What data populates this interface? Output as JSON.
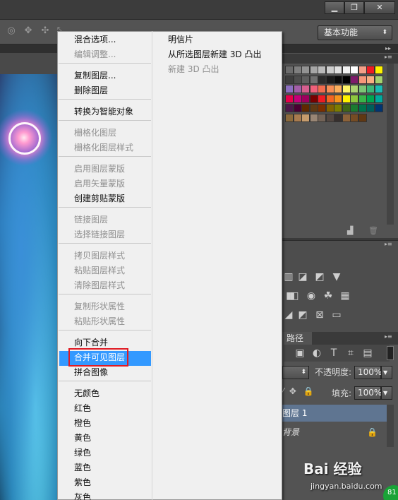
{
  "window": {
    "min": "▁",
    "restore": "❐",
    "close": "✕"
  },
  "options_bar": {
    "workspace": "基本功能"
  },
  "context_menu": {
    "col1": [
      {
        "label": "混合选项...",
        "disabled": false
      },
      {
        "label": "编辑调整...",
        "disabled": true
      },
      {
        "label": "复制图层...",
        "disabled": false
      },
      {
        "label": "删除图层",
        "disabled": false
      },
      {
        "label": "转换为智能对象",
        "disabled": false
      },
      {
        "label": "栅格化图层",
        "disabled": true
      },
      {
        "label": "栅格化图层样式",
        "disabled": true
      },
      {
        "label": "启用图层蒙版",
        "disabled": true
      },
      {
        "label": "启用矢量蒙版",
        "disabled": true
      },
      {
        "label": "创建剪贴蒙版",
        "disabled": false
      },
      {
        "label": "链接图层",
        "disabled": true
      },
      {
        "label": "选择链接图层",
        "disabled": true
      },
      {
        "label": "拷贝图层样式",
        "disabled": true
      },
      {
        "label": "粘贴图层样式",
        "disabled": true
      },
      {
        "label": "清除图层样式",
        "disabled": true
      },
      {
        "label": "复制形状属性",
        "disabled": true
      },
      {
        "label": "粘贴形状属性",
        "disabled": true
      },
      {
        "label": "向下合并",
        "disabled": false
      },
      {
        "label": "合并可见图层",
        "disabled": false,
        "highlighted": true
      },
      {
        "label": "拼合图像",
        "disabled": false
      },
      {
        "label": "无颜色",
        "disabled": false
      },
      {
        "label": "红色",
        "disabled": false
      },
      {
        "label": "橙色",
        "disabled": false
      },
      {
        "label": "黄色",
        "disabled": false
      },
      {
        "label": "绿色",
        "disabled": false
      },
      {
        "label": "蓝色",
        "disabled": false
      },
      {
        "label": "紫色",
        "disabled": false
      },
      {
        "label": "灰色",
        "disabled": false
      }
    ],
    "col2": [
      {
        "label": "明信片",
        "disabled": false
      },
      {
        "label": "从所选图层新建 3D 凸出",
        "disabled": false
      },
      {
        "label": "新建 3D 凸出",
        "disabled": true
      }
    ]
  },
  "layers_panel": {
    "tab": "路径",
    "opacity_label": "不透明度:",
    "opacity_value": "100%",
    "fill_label": "填充:",
    "fill_value": "100%",
    "layers": [
      {
        "name": "图层 1",
        "selected": true
      },
      {
        "name": "背景",
        "selected": false,
        "locked": true
      }
    ]
  },
  "watermark": {
    "brand": "Bai 经验",
    "url": "jingyan.baidu.com",
    "badge": "81"
  },
  "colors": {
    "highlight": "#3399ff",
    "annotation": "#e01b24",
    "menu_bg": "#f0f0f0"
  }
}
